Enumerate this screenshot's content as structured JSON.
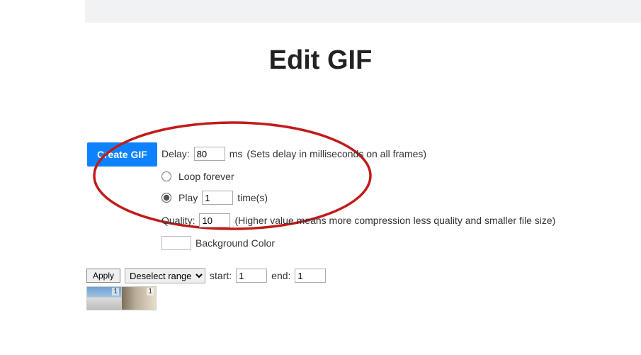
{
  "header": {
    "title": "Edit GIF"
  },
  "create_button": {
    "label": "Create GIF"
  },
  "settings": {
    "delay": {
      "label": "Delay:",
      "value": "80",
      "unit": "ms",
      "hint": "(Sets delay in milliseconds on all frames)"
    },
    "loop_forever": {
      "label": "Loop forever",
      "checked": false
    },
    "play_times": {
      "prefix": "Play",
      "value": "1",
      "suffix": "time(s)",
      "checked": true
    },
    "quality": {
      "label": "Quality:",
      "value": "10",
      "hint": "(Higher value means more compression less quality and smaller file size)"
    },
    "bg_color": {
      "label": "Background Color",
      "value": "#ffffff"
    }
  },
  "range": {
    "apply_label": "Apply",
    "select_value": "Deselect range",
    "start_label": "start:",
    "start_value": "1",
    "end_label": "end:",
    "end_value": "1"
  },
  "thumbnails": [
    {
      "index": "1"
    },
    {
      "index": "1"
    }
  ]
}
